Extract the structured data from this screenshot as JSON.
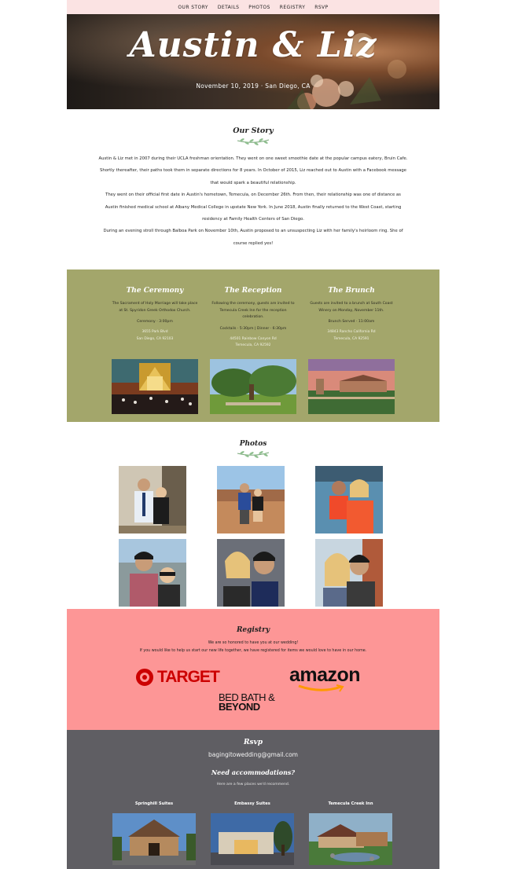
{
  "nav": [
    "OUR STORY",
    "DETAILS",
    "PHOTOS",
    "REGISTRY",
    "RSVP"
  ],
  "hero": {
    "title": "Austin & Liz",
    "subtitle": "November 10, 2019 · San Diego, CA"
  },
  "story": {
    "title": "Our Story",
    "paragraphs": [
      "Austin & Liz met in 2007 during their UCLA freshman orientation. They went on one sweet smoothie date at the popular campus eatery, Bruin Cafe. Shortly thereafter, their paths took them in separate directions for 8 years. In October of 2015, Liz reached out to Austin with a Facebook message that would spark a beautiful relationship.",
      "They went on their official first date in Austin's hometown, Temecula, on December 26th. From then, their relationship was one of distance as Austin finished medical school at Albany Medical College in upstate New York. In June 2018, Austin finally returned to the West Coast, starting residency at Family Health Centers of San Diego.",
      "During an evening stroll through Balboa Park on November 10th, Austin proposed to an unsuspecting Liz with her family's heirloom ring. She of course replied yes!"
    ]
  },
  "events": [
    {
      "title": "The Ceremony",
      "desc": "The Sacrament of Holy Marriage will take place at St. Spyridon Greek Orthodox Church.",
      "time": "Ceremony · 3:00pm",
      "addr1": "3655 Park Blvd",
      "addr2": "San Diego, CA 92103"
    },
    {
      "title": "The Reception",
      "desc": "Following the ceremony, guests are invited to Temecula Creek Inn for the reception celebration.",
      "time": "Cocktails · 5:30pm | Dinner · 6:30pm",
      "addr1": "44501 Rainbow Canyon Rd",
      "addr2": "Temecula, CA 92592"
    },
    {
      "title": "The Brunch",
      "desc": "Guests are invited to a brunch at South Coast Winery on Monday, November 11th.",
      "time": "Brunch Served · 11:00am",
      "addr1": "34843 Rancho California Rd",
      "addr2": "Temecula, CA 92591"
    }
  ],
  "photos": {
    "title": "Photos"
  },
  "registry": {
    "title": "Registry",
    "line1": "We are so honored to have you at our wedding!",
    "line2": "If you would like to help us start our new life together, we have registered for items we would love to have in our home.",
    "target": "TARGET",
    "amazon": "amazon",
    "bbb_line1": "BED BATH &",
    "bbb_line2": "BEYOND"
  },
  "rsvp": {
    "title": "Rsvp",
    "email": "bagingitowedding@gmail.com",
    "accom_title": "Need accommodations?",
    "accom_sub": "Here are a few places we'd recommend.",
    "hotels": [
      "Springhill Suites",
      "Embassy Suites",
      "Temecula Creek Inn"
    ]
  },
  "colors": {
    "nav_bg": "#fbe3e3",
    "events_bg": "#a3a66b",
    "registry_bg": "#fd9696",
    "rsvp_bg": "#5f5e63",
    "target_red": "#cc0000",
    "amazon_orange": "#ff9900"
  }
}
